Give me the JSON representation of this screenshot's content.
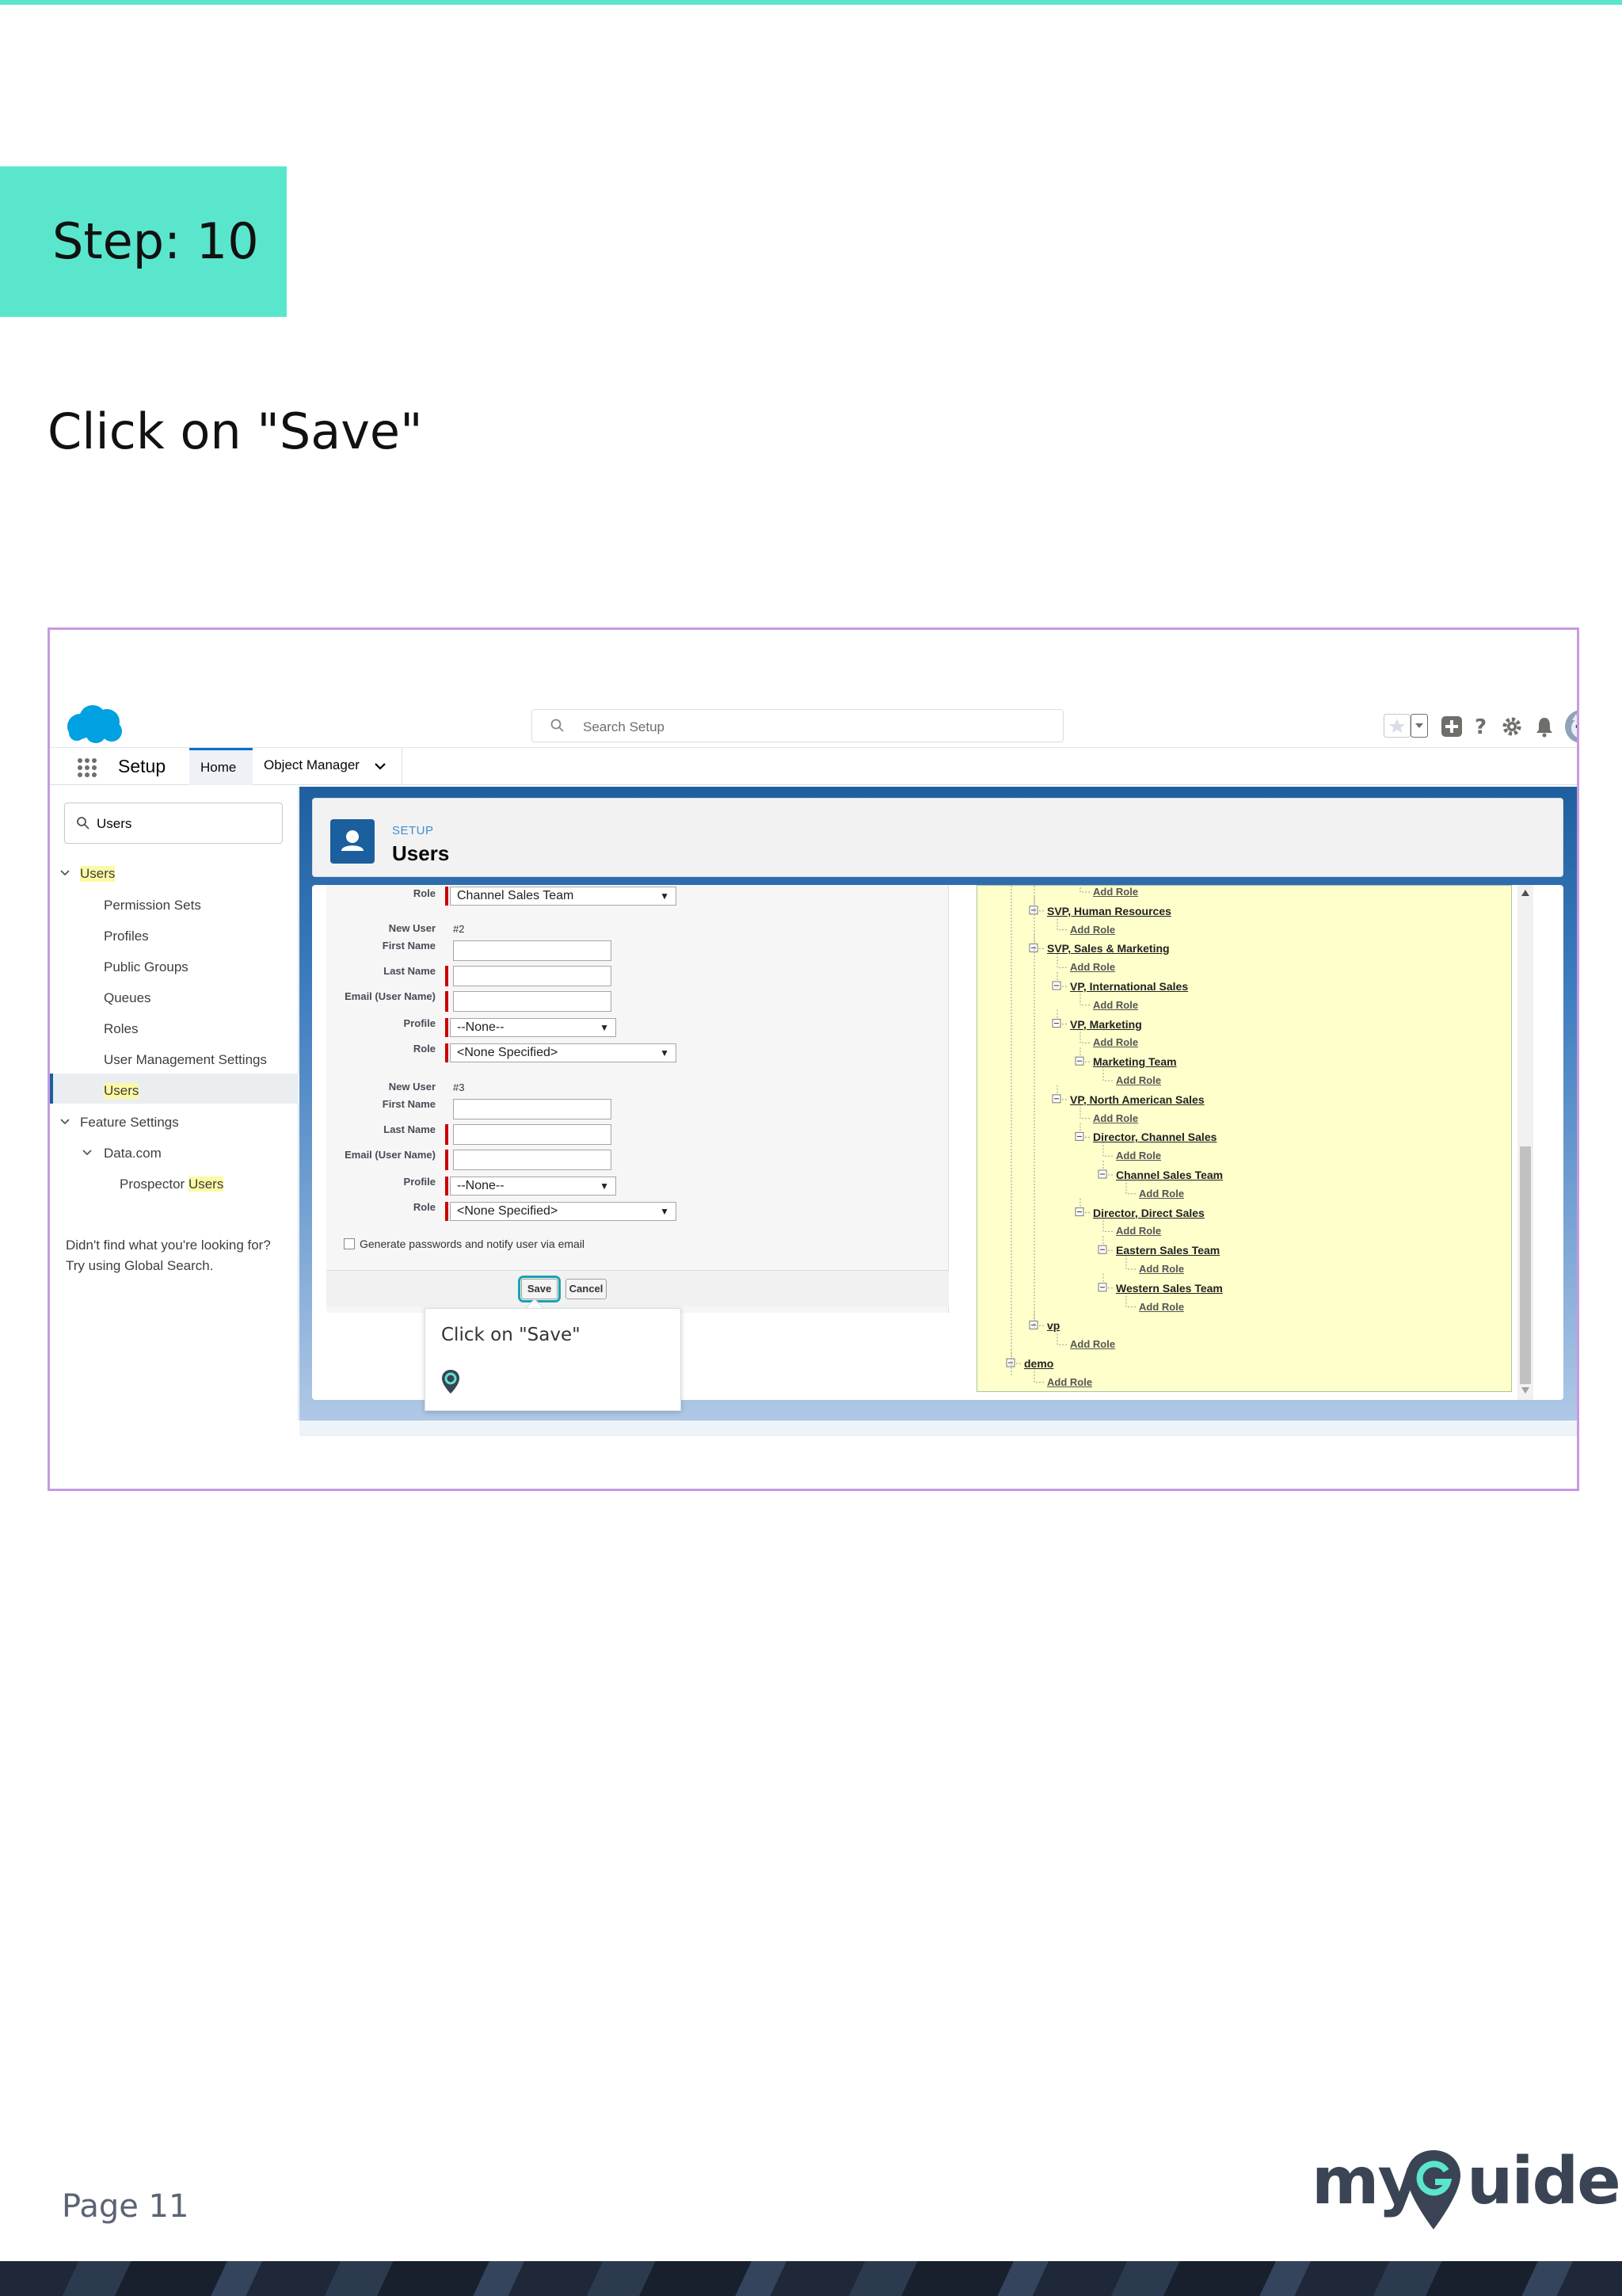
{
  "page": {
    "step_label": "Step: 10",
    "instruction": "Click on \"Save\"",
    "page_number": "Page 11",
    "logo": {
      "text_before": "my",
      "text_after": "uide"
    },
    "accent_color": "#5ae6cd",
    "frame_color": "#c79ae0"
  },
  "app": {
    "search_placeholder": "Search Setup",
    "app_name": "Setup",
    "tabs": [
      {
        "label": "Home",
        "active": true
      },
      {
        "label": "Object Manager",
        "active": false
      }
    ],
    "header_icons": [
      "favorites-star-icon",
      "favorites-dropdown-icon",
      "global-actions-plus-icon",
      "help-question-icon",
      "setup-gear-icon",
      "notifications-bell-icon",
      "user-avatar"
    ]
  },
  "sidebar": {
    "quick_find_value": "Users",
    "items": [
      {
        "label": "Users",
        "level": 0,
        "expanded": true,
        "highlight": true
      },
      {
        "label": "Permission Sets",
        "level": 1
      },
      {
        "label": "Profiles",
        "level": 1
      },
      {
        "label": "Public Groups",
        "level": 1
      },
      {
        "label": "Queues",
        "level": 1
      },
      {
        "label": "Roles",
        "level": 1
      },
      {
        "label": "User Management Settings",
        "level": 1
      },
      {
        "label": "Users",
        "level": 1,
        "selected": true,
        "highlight": true
      },
      {
        "label": "Feature Settings",
        "level": 0,
        "expanded": true
      },
      {
        "label": "Data.com",
        "level": 1,
        "expanded": true
      },
      {
        "label": "Prospector",
        "highlight_suffix": "Users",
        "level": 2
      }
    ],
    "help_line1": "Didn't find what you're looking for?",
    "help_line2": "Try using Global Search."
  },
  "page_header": {
    "eyebrow": "SETUP",
    "title": "Users"
  },
  "form": {
    "first_role_label": "Role",
    "first_role_value": "Channel Sales Team",
    "users": [
      {
        "heading_label": "New User",
        "number": "#2",
        "labels": {
          "first_name": "First Name",
          "last_name": "Last Name",
          "email": "Email (User Name)",
          "profile": "Profile",
          "role": "Role"
        },
        "profile_value": "--None--",
        "role_value": "<None Specified>"
      },
      {
        "heading_label": "New User",
        "number": "#3",
        "labels": {
          "first_name": "First Name",
          "last_name": "Last Name",
          "email": "Email (User Name)",
          "profile": "Profile",
          "role": "Role"
        },
        "profile_value": "--None--",
        "role_value": "<None Specified>"
      }
    ],
    "generate_passwords_label": "Generate passwords and notify user via email",
    "save_label": "Save",
    "cancel_label": "Cancel"
  },
  "tooltip": {
    "text": "Click on \"Save\""
  },
  "role_tree": [
    {
      "label": "Add Role",
      "type": "add",
      "depth": 4
    },
    {
      "label": "SVP, Human Resources",
      "type": "role",
      "depth": 2
    },
    {
      "label": "Add Role",
      "type": "add",
      "depth": 3
    },
    {
      "label": "SVP, Sales & Marketing",
      "type": "role",
      "depth": 2
    },
    {
      "label": "Add Role",
      "type": "add",
      "depth": 3
    },
    {
      "label": "VP, International Sales",
      "type": "role",
      "depth": 3
    },
    {
      "label": "Add Role",
      "type": "add",
      "depth": 4
    },
    {
      "label": "VP, Marketing",
      "type": "role",
      "depth": 3
    },
    {
      "label": "Add Role",
      "type": "add",
      "depth": 4
    },
    {
      "label": "Marketing Team",
      "type": "role",
      "depth": 4
    },
    {
      "label": "Add Role",
      "type": "add",
      "depth": 5
    },
    {
      "label": "VP, North American Sales",
      "type": "role",
      "depth": 3
    },
    {
      "label": "Add Role",
      "type": "add",
      "depth": 4
    },
    {
      "label": "Director, Channel Sales",
      "type": "role",
      "depth": 4
    },
    {
      "label": "Add Role",
      "type": "add",
      "depth": 5
    },
    {
      "label": "Channel Sales Team",
      "type": "role",
      "depth": 5
    },
    {
      "label": "Add Role",
      "type": "add",
      "depth": 6
    },
    {
      "label": "Director, Direct Sales",
      "type": "role",
      "depth": 4
    },
    {
      "label": "Add Role",
      "type": "add",
      "depth": 5
    },
    {
      "label": "Eastern Sales Team",
      "type": "role",
      "depth": 5
    },
    {
      "label": "Add Role",
      "type": "add",
      "depth": 6
    },
    {
      "label": "Western Sales Team",
      "type": "role",
      "depth": 5
    },
    {
      "label": "Add Role",
      "type": "add",
      "depth": 6
    },
    {
      "label": "vp",
      "type": "role",
      "depth": 2
    },
    {
      "label": "Add Role",
      "type": "add",
      "depth": 3
    },
    {
      "label": "demo",
      "type": "role",
      "depth": 1
    },
    {
      "label": "Add Role",
      "type": "add",
      "depth": 2
    }
  ]
}
